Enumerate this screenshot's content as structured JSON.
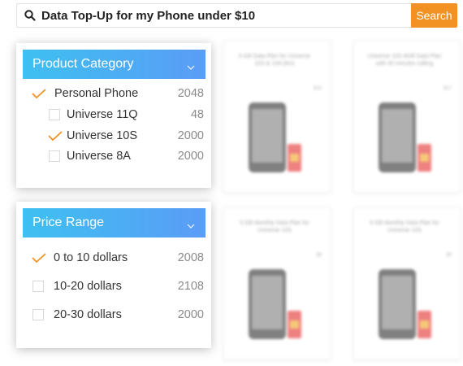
{
  "search": {
    "query": "Data Top-Up for my Phone under $10",
    "button_label": "Search",
    "accent": "#f39224"
  },
  "product_category": {
    "title": "Product Category",
    "items": [
      {
        "label": "Personal Phone",
        "count": "2048",
        "checked": true,
        "level": 0
      },
      {
        "label": "Universe 11Q",
        "count": "48",
        "checked": false,
        "level": 1
      },
      {
        "label": "Universe 10S",
        "count": "2000",
        "checked": true,
        "level": 1
      },
      {
        "label": "Universe 8A",
        "count": "2000",
        "checked": false,
        "level": 1
      }
    ]
  },
  "price_range": {
    "title": "Price Range",
    "items": [
      {
        "label": "0 to 10 dollars",
        "count": "2008",
        "checked": true
      },
      {
        "label": "10-20 dollars",
        "count": "2108",
        "checked": false
      },
      {
        "label": "20-30 dollars",
        "count": "2000",
        "checked": false
      }
    ]
  },
  "products": [
    {
      "title": "5 GB Data Plan for Universe 10S & 10A (6m)",
      "price": "$15"
    },
    {
      "title": "Universe 10S 8GB Data Plan with 30 minutes calling",
      "price": "$17"
    },
    {
      "title": "5 GB Monthly Data Plan for Universe 10S",
      "price": "$8"
    },
    {
      "title": "6 GB Monthly Data Plan for Universe 10S",
      "price": "$9"
    }
  ],
  "colors": {
    "panel_header_start": "#3ec0f1",
    "panel_header_end": "#5a9cf6",
    "check": "#f39224"
  }
}
